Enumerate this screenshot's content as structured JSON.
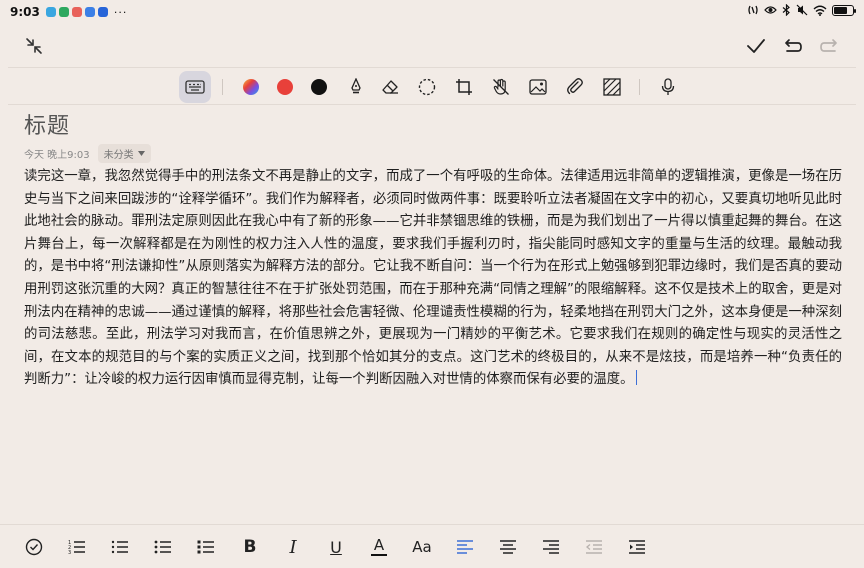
{
  "status": {
    "time": "9:03",
    "more": "···",
    "app_colors": [
      "#3aa6e0",
      "#2ea85f",
      "#e8615a",
      "#3b7fe6",
      "#2764d8"
    ]
  },
  "note": {
    "title": "标题",
    "date": "今天 晚上9:03",
    "category": "未分类",
    "body": "读完这一章，我忽然觉得手中的刑法条文不再是静止的文字，而成了一个有呼吸的生命体。法律适用远非简单的逻辑推演，更像是一场在历史与当下之间来回跋涉的“诠释学循环”。我们作为解释者，必须同时做两件事：既要聆听立法者凝固在文字中的初心，又要真切地听见此时此地社会的脉动。罪刑法定原则因此在我心中有了新的形象——它并非禁锢思维的铁栅，而是为我们划出了一片得以慎重起舞的舞台。在这片舞台上，每一次解释都是在为刚性的权力注入人性的温度，要求我们手握利刃时，指尖能同时感知文字的重量与生活的纹理。最触动我的，是书中将“刑法谦抑性”从原则落实为解释方法的部分。它让我不断自问：当一个行为在形式上勉强够到犯罪边缘时，我们是否真的要动用刑罚这张沉重的大网？真正的智慧往往不在于扩张处罚范围，而在于那种充满“同情之理解”的限缩解释。这不仅是技术上的取舍，更是对刑法内在精神的忠诚——通过谨慎的解释，将那些社会危害轻微、伦理谴责性模糊的行为，轻柔地挡在刑罚大门之外，这本身便是一种深刻的司法慈悲。至此，刑法学习对我而言，在价值思辨之外，更展现为一门精妙的平衡艺术。它要求我们在规则的确定性与现实的灵活性之间，在文本的规范目的与个案的实质正义之间，找到那个恰如其分的支点。这门艺术的终极目的，从来不是炫技，而是培养一种“负责任的判断力”：让冷峻的权力运行因审慎而显得克制，让每一个判断因融入对世情的体察而保有必要的温度。"
  },
  "toolbar": {
    "colors": {
      "red": "#e8403a",
      "black": "#111111"
    },
    "icons": [
      "keyboard-icon",
      "palette-icon",
      "red-color",
      "black-color",
      "pen-icon",
      "eraser-icon",
      "lasso-icon",
      "crop-icon",
      "hand-off-icon",
      "image-icon",
      "attachment-icon",
      "texture-icon",
      "mic-icon"
    ]
  },
  "bottom": {
    "bold": "B",
    "italic": "I",
    "underline": "U",
    "textcolor": "A",
    "fontsize": "Aa"
  },
  "accent": "#3d6fd6"
}
